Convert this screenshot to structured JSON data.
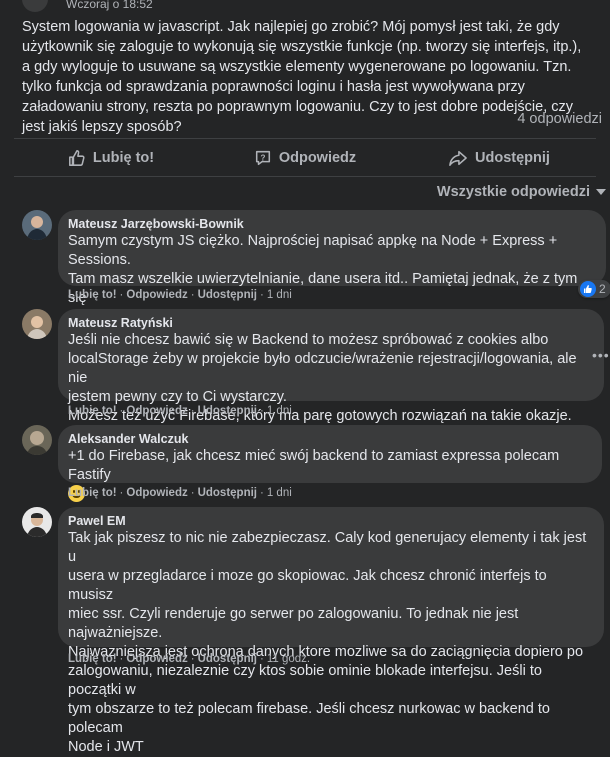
{
  "post": {
    "time": "Wczoraj o 18:52",
    "text": "System logowania w javascript. Jak najlepiej go zrobić? Mój pomysł jest taki, że gdy użytkownik się zaloguje to wykonują się wszystkie funkcje (np. tworzy się interfejs, itp.), a gdy wyloguje to usuwane są wszystkie elementy wygenerowane po logowaniu. Tzn. tylko funkcja od sprawdzania poprawności loginu i hasła jest wywoływana przy załadowaniu strony, reszta po poprawnym logowaniu. Czy to jest dobre podejście, czy jest jakiś lepszy sposób?",
    "reply_count": "4 odpowiedzi"
  },
  "actions": {
    "like": "Lubię to!",
    "comment": "Odpowiedz",
    "share": "Udostępnij"
  },
  "sort": {
    "label": "Wszystkie odpowiedzi"
  },
  "meta_labels": {
    "like": "Lubię to!",
    "reply": "Odpowiedz",
    "share": "Udostępnij"
  },
  "comments": [
    {
      "author": "Mateusz Jarzębowski-Bownik",
      "text": "Samym czystym JS ciężko. Najprościej napisać appkę na Node + Express + Sessions.\nTam masz wszelkie uwierzytelnianie, dane usera itd.. Pamiętaj jednak, że z tym się\nwiążą ścieżki rejestracji, odzyskania i zmiany hasła plus konta userów.",
      "time": "1 dni",
      "reactions": "2"
    },
    {
      "author": "Mateusz Ratyński",
      "text": "Jeśli nie chcesz bawić się w Backend to możesz spróbować z cookies albo\nlocalStorage żeby w projekcie było odczucie/wrażenie rejestracji/logowania, ale nie\njestem pewny czy to Ci wystarczy.\nMożesz też użyć Firebase, który ma parę gotowych rozwiązań na takie okazje.",
      "time": "1 dni"
    },
    {
      "author": "Aleksander Walczuk",
      "text": "+1 do Firebase, jak chcesz mieć swój backend to zamiast expressa polecam Fastify",
      "time": "1 dni"
    },
    {
      "author": "Pawel EM",
      "text": "Tak jak piszesz to nic nie zabezpieczasz. Caly kod generujacy elementy i tak jest u\nusera w przegladarce i moze go skopiowac. Jak chcesz chronić interfejs to musisz\nmiec ssr. Czyli renderuje go serwer po zalogowaniu. To jednak nie jest najważniejsze.\nNajwazniejsza jest ochrona danych ktore mozliwe sa do zaciągnięcia dopiero po\nzalogowaniu, niezaleznie czy ktos sobie ominie blokade interfejsu. Jeśli to początki w\ntym obszarze to też polecam firebase. Jeśli chcesz nurkowac w backend to polecam\nNode i JWT",
      "time": "11 godz."
    }
  ],
  "colors": {
    "background": "#242526",
    "bubble": "#3a3b3c",
    "text": "#e4e6eb",
    "muted": "#b0b3b8",
    "like_blue": "#1877f2"
  }
}
